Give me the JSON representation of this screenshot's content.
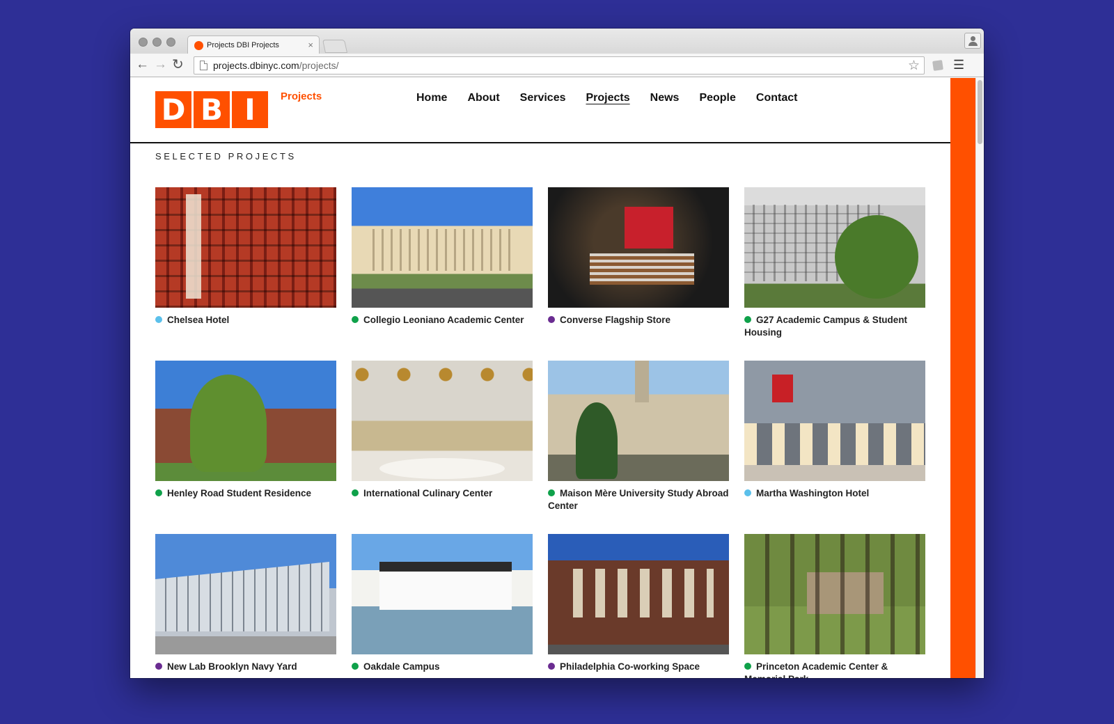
{
  "browser": {
    "tab_title": "Projects DBI Projects",
    "tab_close": "×",
    "url_domain": "projects.dbinyc.com",
    "url_path": "/projects/",
    "icons": {
      "back": "←",
      "forward": "→",
      "reload": "↻",
      "star": "☆",
      "menu": "☰"
    }
  },
  "site": {
    "logo_letters": [
      "D",
      "B",
      "I"
    ],
    "section_label": "Projects",
    "nav": [
      {
        "label": "Home"
      },
      {
        "label": "About"
      },
      {
        "label": "Services"
      },
      {
        "label": "Projects",
        "active": true
      },
      {
        "label": "News"
      },
      {
        "label": "People"
      },
      {
        "label": "Contact"
      }
    ],
    "selected_title": "SELECTED PROJECTS",
    "accent_color": "#ff5000"
  },
  "category_colors": {
    "hospitality": "#5bc0eb",
    "education": "#0fa14a",
    "workplace": "#6a2c91"
  },
  "projects": [
    {
      "name": "Chelsea Hotel",
      "category": "hospitality",
      "image": "hotel"
    },
    {
      "name": "Collegio Leoniano Academic Center",
      "category": "education",
      "image": "collegio"
    },
    {
      "name": "Converse Flagship Store",
      "category": "workplace",
      "image": "converse"
    },
    {
      "name": "G27 Academic Campus & Student Housing",
      "category": "education",
      "image": "g27"
    },
    {
      "name": "Henley Road Student Residence",
      "category": "education",
      "image": "henley"
    },
    {
      "name": "International Culinary Center",
      "category": "education",
      "image": "culinary"
    },
    {
      "name": "Maison Mère University Study Abroad Center",
      "category": "education",
      "image": "maison"
    },
    {
      "name": "Martha Washington Hotel",
      "category": "hospitality",
      "image": "martha"
    },
    {
      "name": "New Lab Brooklyn Navy Yard",
      "category": "workplace",
      "image": "newlab"
    },
    {
      "name": "Oakdale Campus",
      "category": "education",
      "image": "oakdale"
    },
    {
      "name": "Philadelphia Co-working Space",
      "category": "workplace",
      "image": "philly"
    },
    {
      "name": "Princeton Academic Center & Memorial Park",
      "category": "education",
      "image": "princeton"
    }
  ]
}
